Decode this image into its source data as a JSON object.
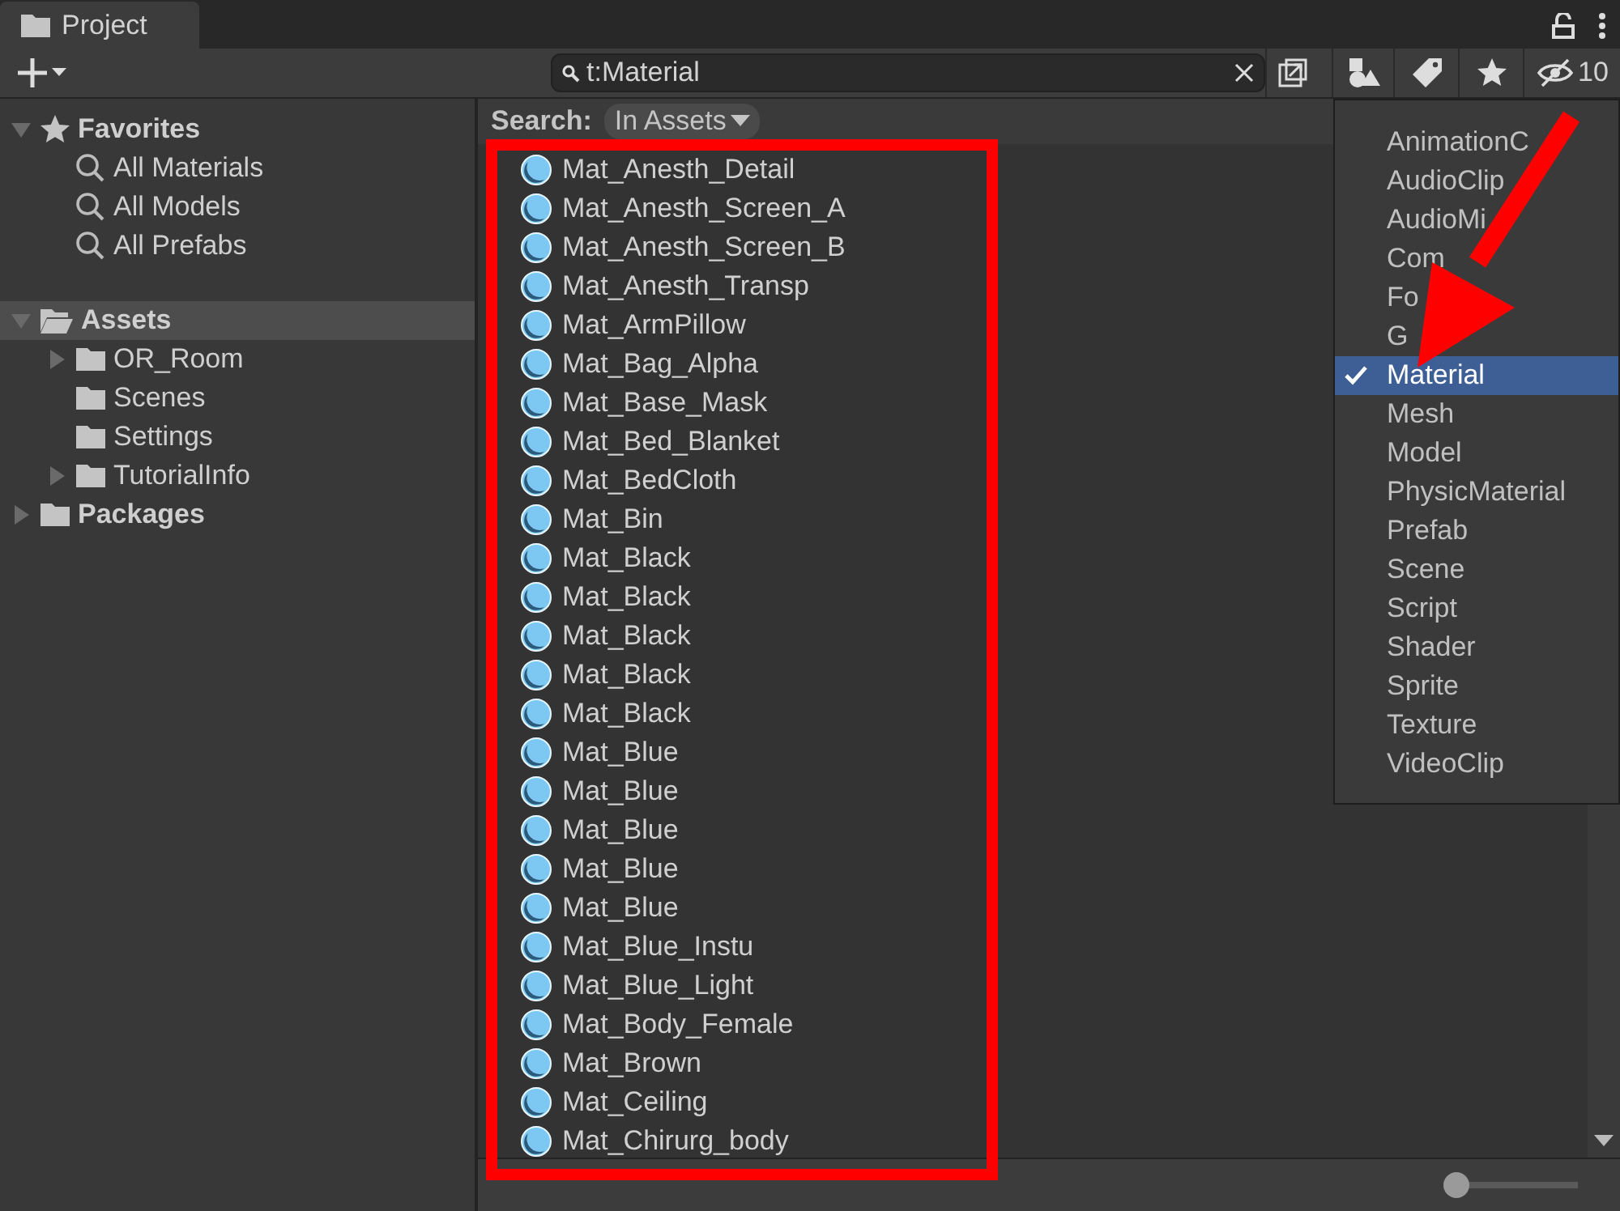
{
  "tab": {
    "title": "Project"
  },
  "search": {
    "value": "t:Material"
  },
  "hidden_packages": {
    "count": "10"
  },
  "tree": [
    {
      "label": "Favorites",
      "kind": "favorites",
      "bold": true,
      "expandable": true,
      "expanded": true,
      "selected": false,
      "children": [
        {
          "label": "All Materials",
          "kind": "search",
          "bold": false,
          "expandable": false,
          "expanded": false,
          "selected": false
        },
        {
          "label": "All Models",
          "kind": "search",
          "bold": false,
          "expandable": false,
          "expanded": false,
          "selected": false
        },
        {
          "label": "All Prefabs",
          "kind": "search",
          "bold": false,
          "expandable": false,
          "expanded": false,
          "selected": false
        }
      ]
    },
    {
      "label": "Assets",
      "kind": "open-folder",
      "bold": true,
      "expandable": true,
      "expanded": true,
      "selected": true,
      "children": [
        {
          "label": "OR_Room",
          "kind": "folder",
          "bold": false,
          "expandable": true,
          "expanded": false,
          "selected": false
        },
        {
          "label": "Scenes",
          "kind": "folder",
          "bold": false,
          "expandable": false,
          "expanded": false,
          "selected": false
        },
        {
          "label": "Settings",
          "kind": "folder",
          "bold": false,
          "expandable": false,
          "expanded": false,
          "selected": false
        },
        {
          "label": "TutorialInfo",
          "kind": "folder",
          "bold": false,
          "expandable": true,
          "expanded": false,
          "selected": false
        }
      ]
    },
    {
      "label": "Packages",
      "kind": "folder",
      "bold": true,
      "expandable": true,
      "expanded": false,
      "selected": false
    }
  ],
  "search_scope": {
    "label": "Search:",
    "scope": "In Assets"
  },
  "results": [
    "Mat_Anesth_Detail",
    "Mat_Anesth_Screen_A",
    "Mat_Anesth_Screen_B",
    "Mat_Anesth_Transp",
    "Mat_ArmPillow",
    "Mat_Bag_Alpha",
    "Mat_Base_Mask",
    "Mat_Bed_Blanket",
    "Mat_BedCloth",
    "Mat_Bin",
    "Mat_Black",
    "Mat_Black",
    "Mat_Black",
    "Mat_Black",
    "Mat_Black",
    "Mat_Blue",
    "Mat_Blue",
    "Mat_Blue",
    "Mat_Blue",
    "Mat_Blue",
    "Mat_Blue_Instu",
    "Mat_Blue_Light",
    "Mat_Body_Female",
    "Mat_Brown",
    "Mat_Ceiling",
    "Mat_Chirurg_body"
  ],
  "type_menu": [
    {
      "label": "AnimationC",
      "selected": false
    },
    {
      "label": "AudioClip",
      "selected": false
    },
    {
      "label": "AudioMi",
      "selected": false
    },
    {
      "label": "Com",
      "selected": false
    },
    {
      "label": "Fo",
      "selected": false
    },
    {
      "label": "G",
      "selected": false
    },
    {
      "label": "Material",
      "selected": true
    },
    {
      "label": "Mesh",
      "selected": false
    },
    {
      "label": "Model",
      "selected": false
    },
    {
      "label": "PhysicMaterial",
      "selected": false
    },
    {
      "label": "Prefab",
      "selected": false
    },
    {
      "label": "Scene",
      "selected": false
    },
    {
      "label": "Script",
      "selected": false
    },
    {
      "label": "Shader",
      "selected": false
    },
    {
      "label": "Sprite",
      "selected": false
    },
    {
      "label": "Texture",
      "selected": false
    },
    {
      "label": "VideoClip",
      "selected": false
    }
  ],
  "zoom_slider": {
    "level": 0
  },
  "annotations": [
    {
      "kind": "box"
    },
    {
      "kind": "arrow"
    }
  ]
}
